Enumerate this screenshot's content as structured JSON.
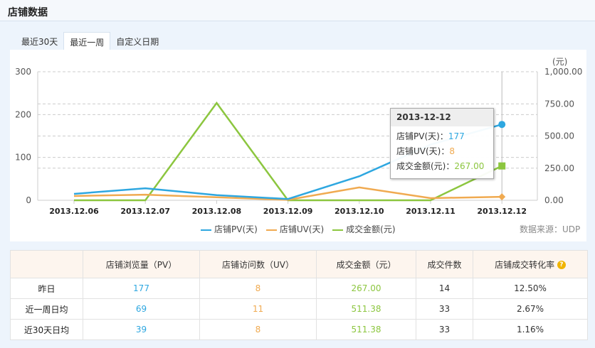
{
  "header": {
    "title": "店铺数据"
  },
  "tabs": [
    {
      "label": "最近30天",
      "active": false
    },
    {
      "label": "最近一周",
      "active": true
    },
    {
      "label": "自定义日期",
      "active": false
    }
  ],
  "colors": {
    "pv": "#2ea7e0",
    "uv": "#f0aa50",
    "gmv": "#8cc63f"
  },
  "chart_data": {
    "type": "line",
    "categories": [
      "2013.12.06",
      "2013.12.07",
      "2013.12.08",
      "2013.12.09",
      "2013.12.10",
      "2013.12.11",
      "2013.12.12"
    ],
    "left_axis": {
      "ylim": [
        0,
        300
      ],
      "ticks": [
        "0",
        "100",
        "200",
        "300"
      ]
    },
    "right_axis": {
      "unit": "(元)",
      "ylim": [
        0,
        1000
      ],
      "ticks": [
        "0.00",
        "250.00",
        "500.00",
        "750.00",
        "1,000.00"
      ]
    },
    "series": [
      {
        "name": "店铺PV(天)",
        "axis": "left",
        "color": "#2ea7e0",
        "values": [
          15,
          28,
          12,
          3,
          56,
          130,
          177
        ]
      },
      {
        "name": "店铺UV(天)",
        "axis": "left",
        "color": "#f0aa50",
        "values": [
          10,
          13,
          7,
          1,
          30,
          5,
          8
        ]
      },
      {
        "name": "成交金额(元)",
        "axis": "right",
        "color": "#8cc63f",
        "values": [
          0,
          0,
          757,
          0,
          0,
          0,
          267
        ]
      }
    ],
    "grid": true,
    "legend": "bottom"
  },
  "tooltip": {
    "title": "2013-12-12",
    "rows": [
      {
        "label": "店铺PV(天)：",
        "value": "177"
      },
      {
        "label": "店铺UV(天)：",
        "value": "8"
      },
      {
        "label": "成交金额(元)：",
        "value": "267.00"
      }
    ]
  },
  "source": "数据来源：UDP",
  "table": {
    "headers": [
      "",
      "店铺浏览量（PV）",
      "店铺访问数（UV）",
      "成交金额（元）",
      "成交件数",
      "店铺成交转化率"
    ],
    "help_icon": "?",
    "rows": [
      [
        "昨日",
        "177",
        "8",
        "267.00",
        "14",
        "12.50%"
      ],
      [
        "近一周日均",
        "69",
        "11",
        "511.38",
        "33",
        "2.67%"
      ],
      [
        "近30天日均",
        "39",
        "8",
        "511.38",
        "33",
        "1.16%"
      ]
    ]
  }
}
